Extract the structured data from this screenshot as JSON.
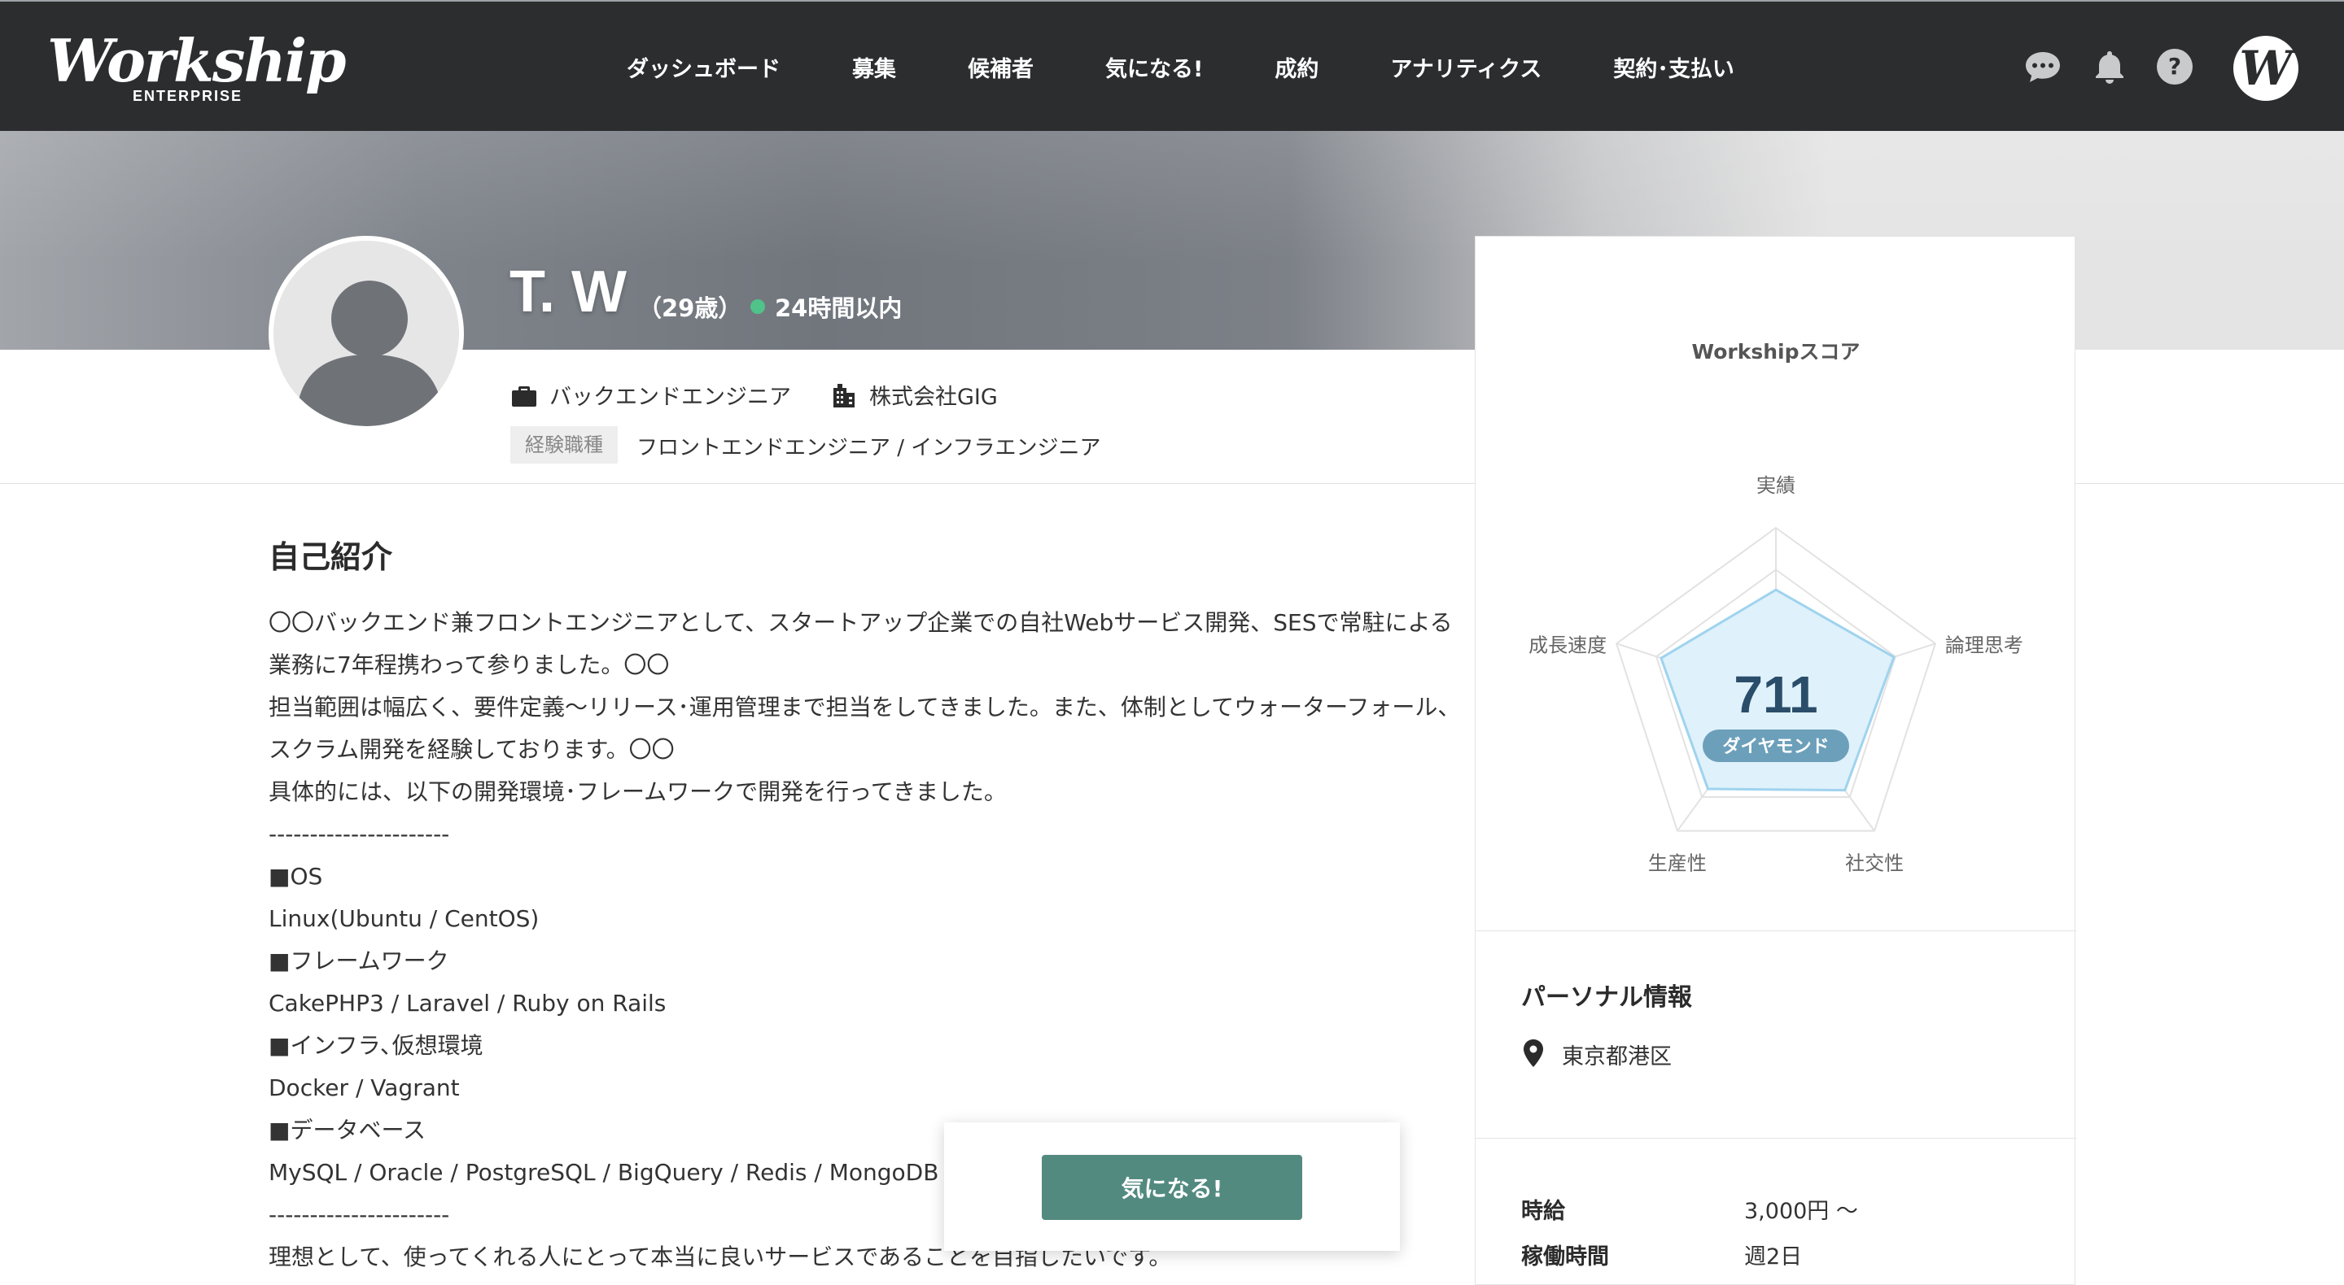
{
  "brand": {
    "name": "Workship",
    "sub": "ENTERPRISE",
    "avatar_letter": "W"
  },
  "nav": {
    "items": [
      "ダッシュボード",
      "募集",
      "候補者",
      "気になる!",
      "成約",
      "アナリティクス",
      "契約･支払い"
    ]
  },
  "profile": {
    "name": "T. W",
    "age": "（29歳）",
    "online": "24時間以内",
    "job_title": "バックエンドエンジニア",
    "company": "株式会社GIG",
    "experience_label": "経験職種",
    "experience": "フロントエンドエンジニア / インフラエンジニア"
  },
  "intro": {
    "title": "自己紹介",
    "lines": [
      "〇〇バックエンド兼フロントエンジニアとして、スタートアップ企業での自社Webサービス開発、SESで常駐による",
      "業務に7年程携わって参りました。〇〇",
      "担当範囲は幅広く、要件定義〜リリース･運用管理まで担当をしてきました。また、体制としてウォーターフォール、",
      "スクラム開発を経験しております。〇〇",
      "具体的には、以下の開発環境･フレームワークで開発を行ってきました。",
      "----------------------",
      "■OS",
      "Linux(Ubuntu / CentOS)",
      "■フレームワーク",
      "CakePHP3 / Laravel / Ruby on Rails",
      "■インフラ､仮想環境",
      "Docker / Vagrant",
      "■データベース",
      "MySQL / Oracle / PostgreSQL / BigQuery / Redis / MongoDB",
      "----------------------",
      "理想として、使ってくれる人にとって本当に良いサービスであることを目指したいです。"
    ]
  },
  "score": {
    "title": "Workshipスコア",
    "value": "711",
    "rank": "ダイヤモンド",
    "axes": [
      "実績",
      "論理思考",
      "社交性",
      "生産性",
      "成長速度"
    ],
    "levels": [
      0.63,
      0.74,
      0.7,
      0.69,
      0.72
    ]
  },
  "personal": {
    "title": "パーソナル情報",
    "location": "東京都港区",
    "rate_label": "時給",
    "rate_value": "3,000円 〜",
    "hours_label": "稼働時間",
    "hours_value": "週2日"
  },
  "action": {
    "favorite_label": "気になる!"
  },
  "colors": {
    "nav_bg": "#2c2d2f",
    "accent": "#528a80",
    "online": "#4fc38a",
    "radar_fill": "#dff1fb",
    "radar_stroke": "#9fd3ee",
    "badge": "#6c9fba"
  }
}
